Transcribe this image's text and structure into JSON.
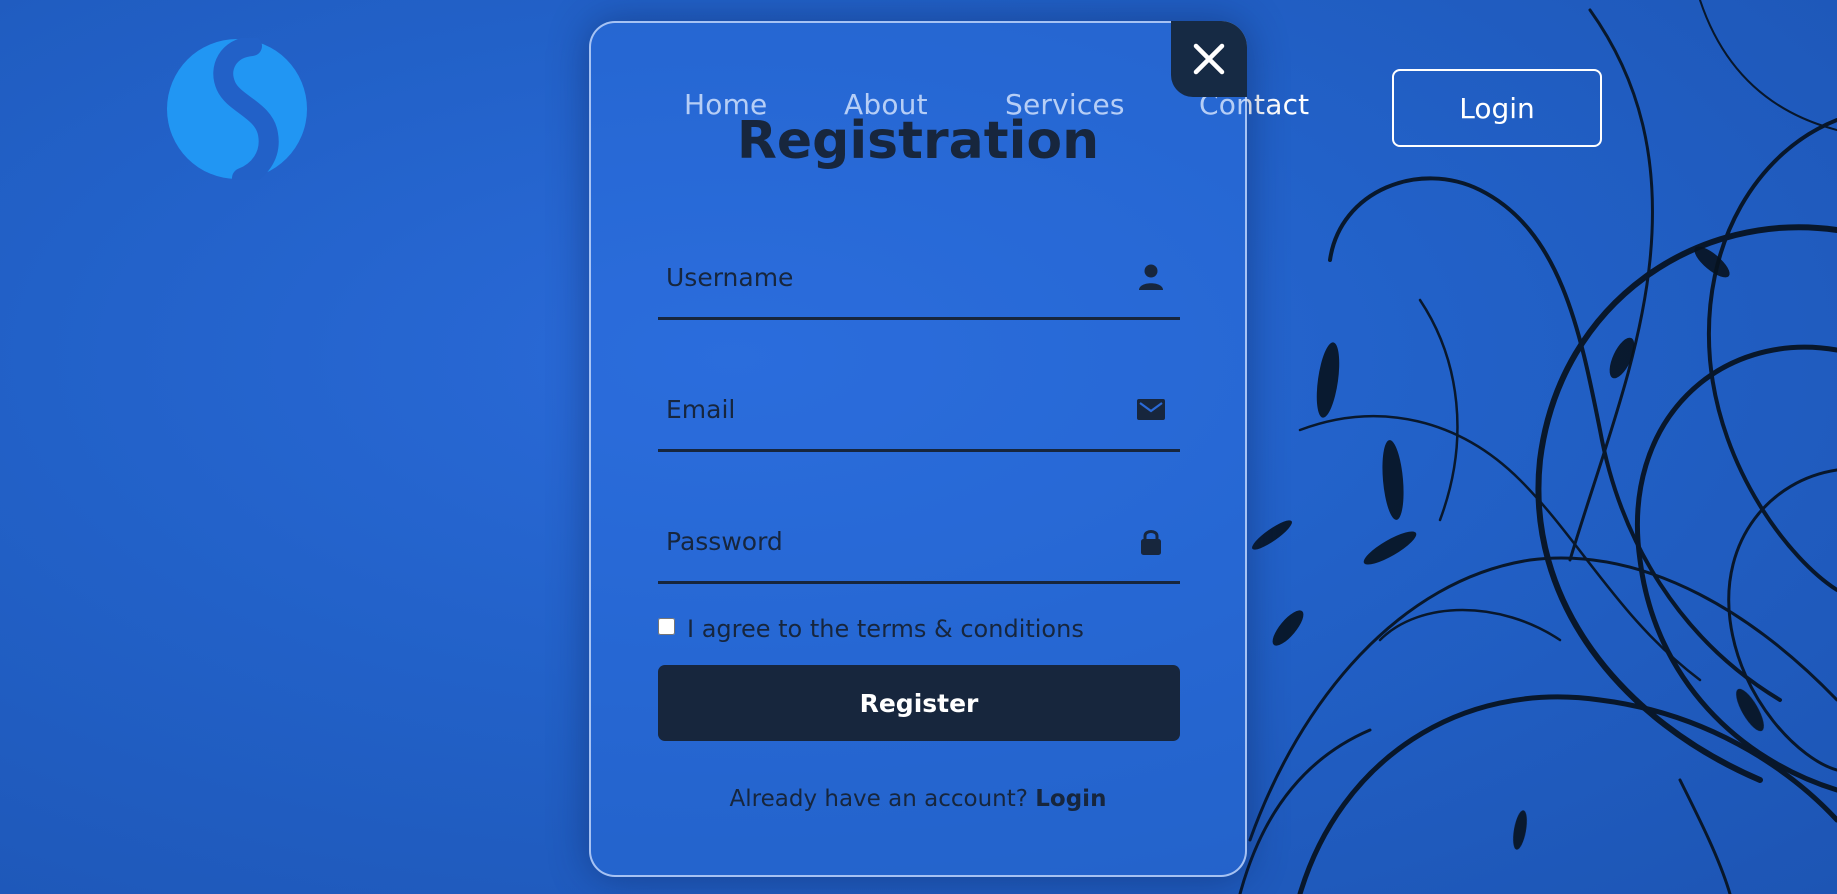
{
  "nav": {
    "links": [
      {
        "label": "Home"
      },
      {
        "label": "About"
      },
      {
        "label": "Services"
      },
      {
        "label": "Contact"
      }
    ],
    "login_label": "Login"
  },
  "logo": {
    "icon": "s-logo-icon",
    "color": "#2196f3"
  },
  "modal": {
    "title": "Registration",
    "close_icon": "close-icon",
    "fields": [
      {
        "placeholder": "Username",
        "value": "",
        "icon": "user-icon"
      },
      {
        "placeholder": "Email",
        "value": "",
        "icon": "mail-icon"
      },
      {
        "placeholder": "Password",
        "value": "",
        "icon": "lock-icon"
      }
    ],
    "terms_label": "I agree to the terms & conditions",
    "terms_checked": false,
    "register_label": "Register",
    "already_text": "Already have an account?",
    "login_link": "Login"
  },
  "colors": {
    "background": "#2261c8",
    "dark": "#17263d",
    "accent": "#2196f3",
    "white": "#ffffff"
  }
}
